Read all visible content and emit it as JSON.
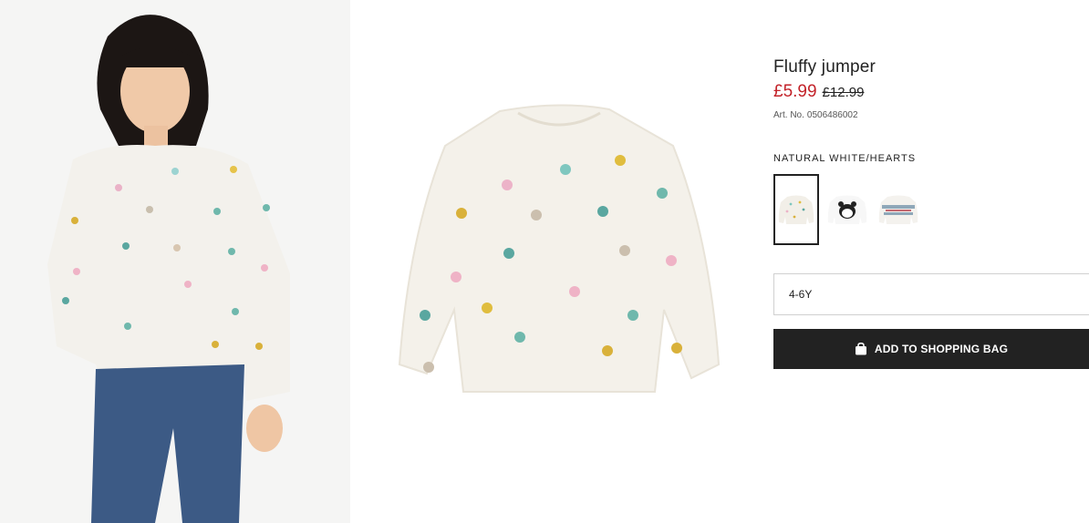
{
  "product": {
    "title": "Fluffy jumper",
    "price_sale": "£5.99",
    "price_old": "£12.99",
    "article_label": "Art. No.",
    "article_number": "0506486002"
  },
  "colour": {
    "selected_name": "NATURAL WHITE/HEARTS",
    "swatches": [
      {
        "name": "natural-white-hearts",
        "selected": true
      },
      {
        "name": "white-panda",
        "selected": false
      },
      {
        "name": "white-pattern",
        "selected": false
      }
    ]
  },
  "size": {
    "selected": "4-6Y"
  },
  "cart": {
    "add_label": "ADD TO SHOPPING BAG",
    "icon": "shopping-bag-icon"
  },
  "colors": {
    "sale": "#c3232a",
    "button": "#222222"
  }
}
